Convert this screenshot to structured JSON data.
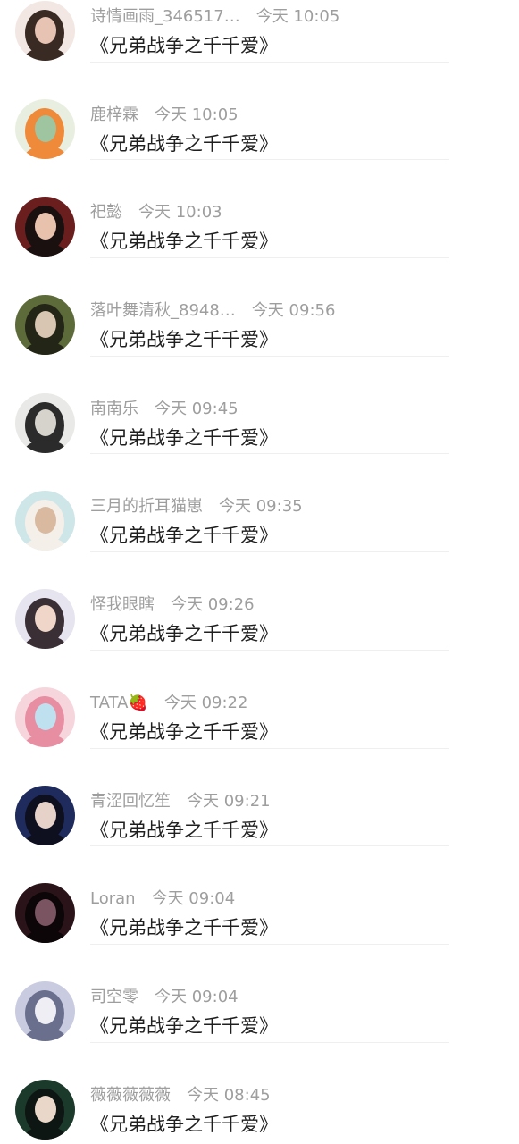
{
  "comments": [
    {
      "username": "诗情画雨_346517…",
      "time": "今天 10:05",
      "text": "《兄弟战争之千千爱》",
      "avatar_icon": "avatar-girl-deer-antlers",
      "avatar_colors": [
        "#f2e7e2",
        "#3a2a24",
        "#e7c3b4"
      ]
    },
    {
      "username": "鹿梓霖",
      "time": "今天 10:05",
      "text": "《兄弟战争之千千爱》",
      "avatar_icon": "avatar-anime-orange-hair",
      "avatar_colors": [
        "#e9efe0",
        "#ef8a3a",
        "#9fc4a0"
      ]
    },
    {
      "username": "祀懿",
      "time": "今天 10:03",
      "text": "《兄弟战争之千千爱》",
      "avatar_icon": "avatar-girl-dark-hair",
      "avatar_colors": [
        "#6b1e1e",
        "#1a1010",
        "#e9c2ae"
      ]
    },
    {
      "username": "落叶舞清秋_8948…",
      "time": "今天 09:56",
      "text": "《兄弟战争之千千爱》",
      "avatar_icon": "avatar-girl-field",
      "avatar_colors": [
        "#5d6b3a",
        "#232616",
        "#d8c6b2"
      ]
    },
    {
      "username": "南南乐",
      "time": "今天 09:45",
      "text": "《兄弟战争之千千爱》",
      "avatar_icon": "avatar-bow-ribbon",
      "avatar_colors": [
        "#e9e9e7",
        "#2b2b2b",
        "#d6d2cc"
      ]
    },
    {
      "username": "三月的折耳猫崽",
      "time": "今天 09:35",
      "text": "《兄弟战争之千千爱》",
      "avatar_icon": "avatar-white-puppy",
      "avatar_colors": [
        "#cfe6e9",
        "#f4efe9",
        "#d9b9a0"
      ]
    },
    {
      "username": "怪我眼瞎",
      "time": "今天 09:26",
      "text": "《兄弟战争之千千爱》",
      "avatar_icon": "avatar-girl-sitting",
      "avatar_colors": [
        "#e6e4ef",
        "#3b2f36",
        "#f0d6c8"
      ]
    },
    {
      "username": "TATA🍓",
      "time": "今天 09:22",
      "text": "《兄弟战争之千千爱》",
      "avatar_icon": "avatar-anime-pink-hair",
      "avatar_colors": [
        "#f6d6dc",
        "#e88ea2",
        "#bfe0ef"
      ]
    },
    {
      "username": "青涩回忆笙",
      "time": "今天 09:21",
      "text": "《兄弟战争之千千爱》",
      "avatar_icon": "avatar-boy-blue",
      "avatar_colors": [
        "#1e2b5c",
        "#0e1020",
        "#e6d2c8"
      ]
    },
    {
      "username": "Loran",
      "time": "今天 09:04",
      "text": "《兄弟战争之千千爱》",
      "avatar_icon": "avatar-dark-figure",
      "avatar_colors": [
        "#2a1419",
        "#0c0608",
        "#7a5561"
      ]
    },
    {
      "username": "司空零",
      "time": "今天 09:04",
      "text": "《兄弟战争之千千爱》",
      "avatar_icon": "avatar-anime-silver-hair",
      "avatar_colors": [
        "#c9cce0",
        "#6b6f8e",
        "#eeeef4"
      ]
    },
    {
      "username": "薇薇薇薇薇",
      "time": "今天 08:45",
      "text": "《兄弟战争之千千爱》",
      "avatar_icon": "avatar-group-drama",
      "avatar_colors": [
        "#1c3a2c",
        "#0d1612",
        "#e9d8c9"
      ]
    }
  ]
}
